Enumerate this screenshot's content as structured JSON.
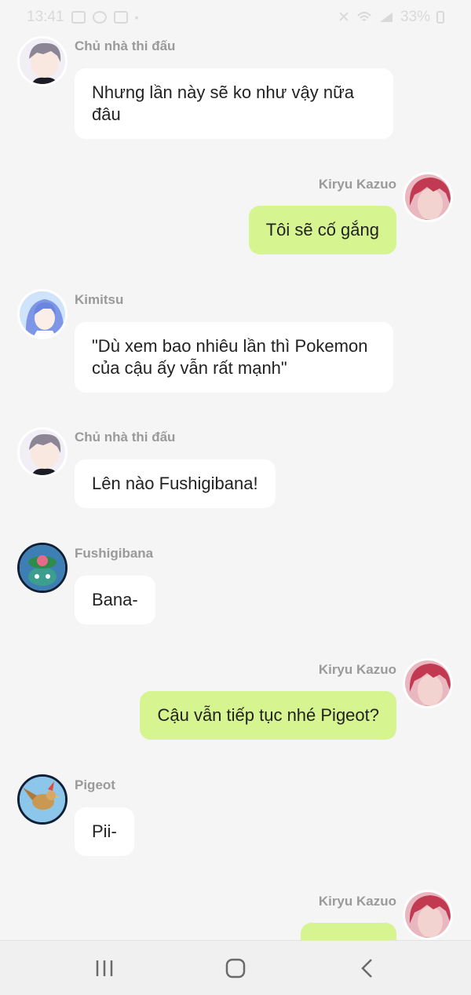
{
  "status_bar": {
    "time": "13:41",
    "battery": "33%",
    "left_icons": [
      "image-icon",
      "no-disturb-icon",
      "app-icon"
    ],
    "right_icons": [
      "mute-icon",
      "wifi-icon",
      "signal-icon",
      "battery-icon"
    ]
  },
  "messages": [
    {
      "sender": "Chủ nhà thi đấu",
      "text": "Nhưng lần này sẽ ko như vậy nữa đâu",
      "side": "left",
      "avatar": "gym-leader-avatar"
    },
    {
      "sender": "Kiryu Kazuo",
      "text": "Tôi sẽ cố gắng",
      "side": "right",
      "avatar": "kiryu-kazuo-avatar"
    },
    {
      "sender": "Kimitsu",
      "text": "\"Dù xem bao nhiêu lần thì Pokemon của cậu ấy vẫn rất mạnh\"",
      "side": "left",
      "avatar": "kimitsu-avatar"
    },
    {
      "sender": "Chủ nhà thi đấu",
      "text": "Lên nào Fushigibana!",
      "side": "left",
      "avatar": "gym-leader-avatar"
    },
    {
      "sender": "Fushigibana",
      "text": "Bana-",
      "side": "left",
      "avatar": "fushigibana-avatar"
    },
    {
      "sender": "Kiryu Kazuo",
      "text": "Cậu vẫn tiếp tục nhé Pigeot?",
      "side": "right",
      "avatar": "kiryu-kazuo-avatar"
    },
    {
      "sender": "Pigeot",
      "text": "Pii-",
      "side": "left",
      "avatar": "pigeot-avatar"
    },
    {
      "sender": "Kiryu Kazuo",
      "text": "",
      "side": "right",
      "avatar": "kiryu-kazuo-avatar"
    }
  ],
  "nav": {
    "recent_icon": "recent-apps-icon",
    "home_icon": "home-icon",
    "back_icon": "back-icon"
  },
  "colors": {
    "background": "#f5f5f5",
    "left_bubble": "#ffffff",
    "right_bubble": "#d6f590",
    "sender_name": "#9a9a9a"
  }
}
